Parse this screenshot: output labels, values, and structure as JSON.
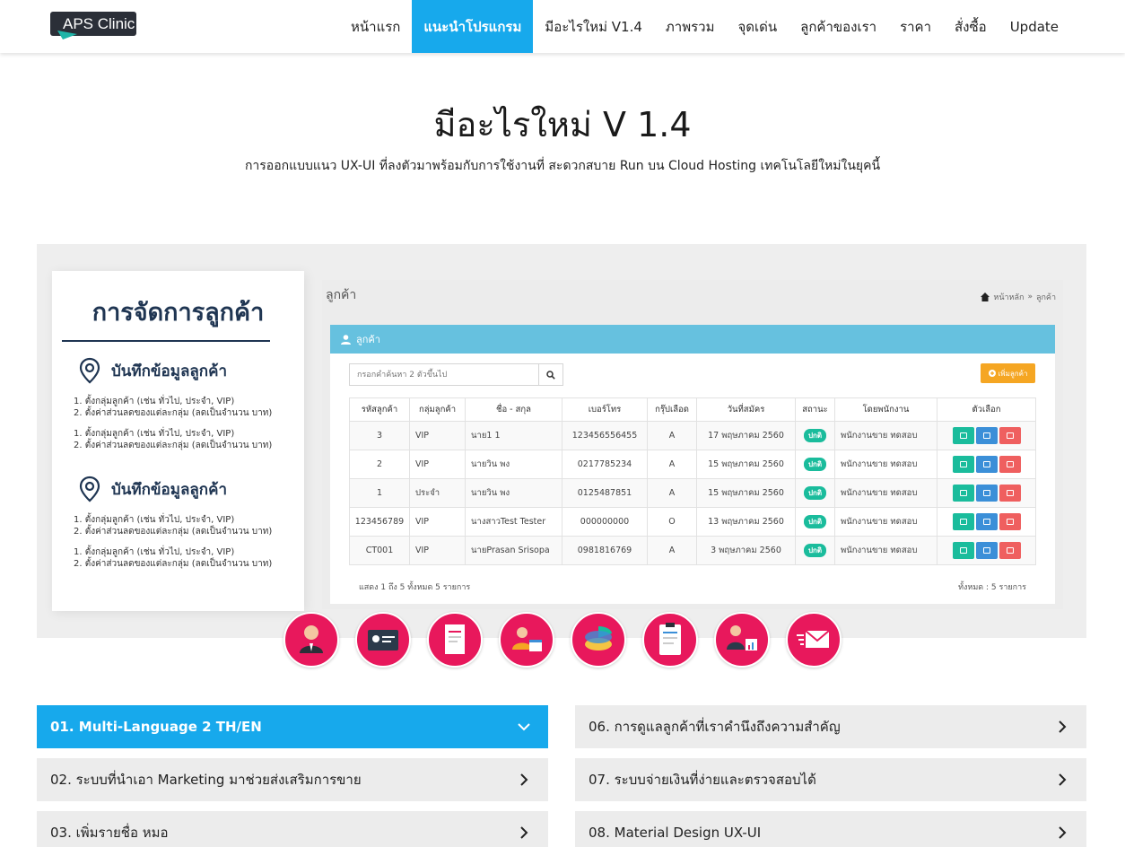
{
  "navbar": {
    "logo_text": "APS Clinic",
    "items": [
      {
        "label": "หน้าแรก"
      },
      {
        "label": "แนะนำโปรแกรม",
        "active": true
      },
      {
        "label": "มีอะไรใหม่ V1.4"
      },
      {
        "label": "ภาพรวม"
      },
      {
        "label": "จุดเด่น"
      },
      {
        "label": "ลูกค้าของเรา"
      },
      {
        "label": "ราคา"
      },
      {
        "label": "สั่งซื้อ"
      },
      {
        "label": "Update"
      }
    ]
  },
  "hero": {
    "title": "มีอะไรใหม่ V 1.4",
    "subtitle": "การออกแบบแนว UX-UI ที่ลงตัวมาพร้อมกับการใช้งานที่ สะดวกสบาย Run บน Cloud Hosting เทคโนโลยีใหม่ในยุคนี้"
  },
  "banner": {
    "card": {
      "title": "การจัดการลูกค้า",
      "sections": [
        {
          "heading": "บันทึกข้อมูลลูกค้า",
          "lines": [
            "1. ตั้งกลุ่มลูกค้า (เช่น ทั่วไป, ประจำ, VIP)",
            "2. ตั้งค่าส่วนลดของแต่ละกลุ่ม (ลดเป็นจำนวน บาท)",
            "1. ตั้งกลุ่มลูกค้า (เช่น ทั่วไป, ประจำ, VIP)",
            "2. ตั้งค่าส่วนลดของแต่ละกลุ่ม (ลดเป็นจำนวน บาท)"
          ]
        },
        {
          "heading": "บันทึกข้อมูลลูกค้า",
          "lines": [
            "1. ตั้งกลุ่มลูกค้า (เช่น ทั่วไป, ประจำ, VIP)",
            "2. ตั้งค่าส่วนลดของแต่ละกลุ่ม (ลดเป็นจำนวน บาท)",
            "1. ตั้งกลุ่มลูกค้า (เช่น ทั่วไป, ประจำ, VIP)",
            "2. ตั้งค่าส่วนลดของแต่ละกลุ่ม (ลดเป็นจำนวน บาท)"
          ]
        }
      ]
    },
    "app": {
      "page_title": "ลูกค้า",
      "breadcrumb_home": "หน้าหลัก",
      "breadcrumb_sep": "»",
      "breadcrumb_current": "ลูกค้า",
      "panel_title": "ลูกค้า",
      "search_placeholder": "กรอกคำค้นหา 2 ตัวขึ้นไป",
      "add_button": "เพิ่มลูกค้า",
      "columns": [
        "รหัสลูกค้า",
        "กลุ่มลูกค้า",
        "ชื่อ - สกุล",
        "เบอร์โทร",
        "กรุ๊ปเลือด",
        "วันที่สมัคร",
        "สถานะ",
        "โดยพนักงาน",
        "ตัวเลือก"
      ],
      "rows": [
        {
          "id": "3",
          "group": "VIP",
          "name": "นาย1 1",
          "phone": "123456556455",
          "blood": "A",
          "date": "17 พฤษภาคม 2560",
          "status": "ปกติ",
          "staff": "พนักงานขาย ทดสอบ"
        },
        {
          "id": "2",
          "group": "VIP",
          "name": "นายวิน พง",
          "phone": "0217785234",
          "blood": "A",
          "date": "15 พฤษภาคม 2560",
          "status": "ปกติ",
          "staff": "พนักงานขาย ทดสอบ"
        },
        {
          "id": "1",
          "group": "ประจำ",
          "name": "นายวิน พง",
          "phone": "0125487851",
          "blood": "A",
          "date": "15 พฤษภาคม 2560",
          "status": "ปกติ",
          "staff": "พนักงานขาย ทดสอบ"
        },
        {
          "id": "123456789",
          "group": "VIP",
          "name": "นางสาวTest Tester",
          "phone": "000000000",
          "blood": "O",
          "date": "13 พฤษภาคม 2560",
          "status": "ปกติ",
          "staff": "พนักงานขาย ทดสอบ"
        },
        {
          "id": "CT001",
          "group": "VIP",
          "name": "นายPrasan Srisopa",
          "phone": "0981816769",
          "blood": "A",
          "date": "3 พฤษภาคม 2560",
          "status": "ปกติ",
          "staff": "พนักงานขาย ทดสอบ"
        }
      ],
      "footer_left": "แสดง 1 ถึง 5 ทั้งหมด 5 รายการ",
      "footer_right": "ทั้งหมด : 5 รายการ"
    },
    "feature_icons": [
      "customer-icon",
      "id-card-icon",
      "receipt-icon",
      "staff-calendar-icon",
      "pie-chart-icon",
      "clipboard-icon",
      "presenter-chart-icon",
      "email-icon"
    ]
  },
  "accordion": {
    "left": [
      {
        "label": "01. Multi-Language 2 TH/EN",
        "active": true
      },
      {
        "label": "02. ระบบที่นำเอา Marketing มาช่วยส่งเสริมการขาย"
      },
      {
        "label": "03. เพิ่มรายชื่อ หมอ"
      }
    ],
    "right": [
      {
        "label": "06. การดูแลลูกค้าที่เราคำนึงถึงความสำคัญ"
      },
      {
        "label": "07. ระบบจ่ายเงินที่ง่ายและตรวจสอบได้"
      },
      {
        "label": "08. Material Design UX-UI"
      }
    ]
  },
  "colors": {
    "accent": "#17a9ec",
    "brand_pink": "#e8185c",
    "status_green": "#1abc9c",
    "add_orange": "#f5a623",
    "panel_blue": "#66c1df"
  }
}
